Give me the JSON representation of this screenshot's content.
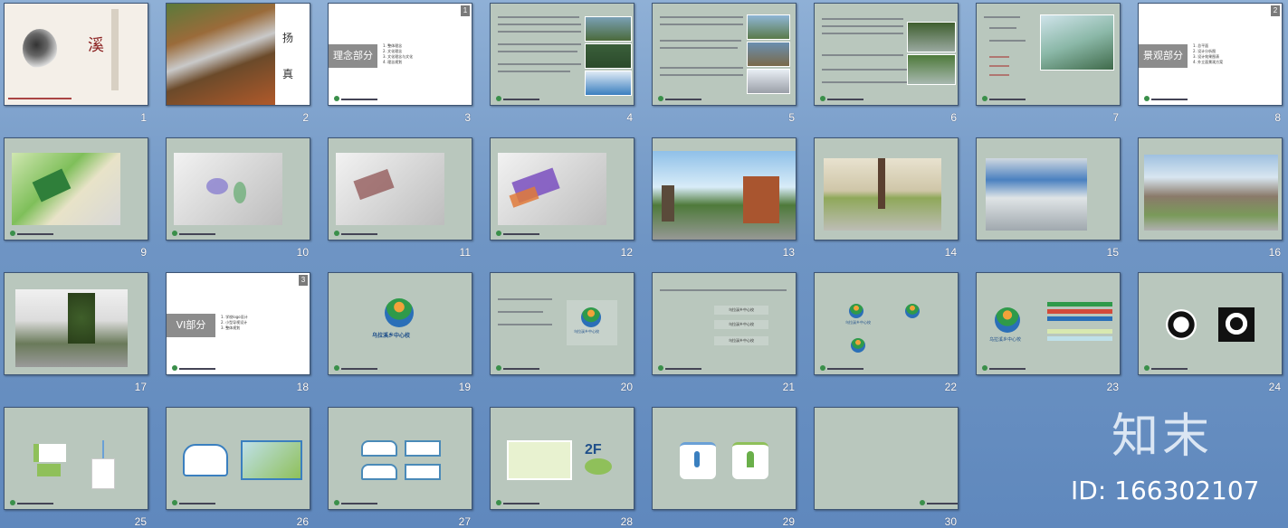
{
  "slides": [
    {
      "num": "1",
      "title": "溪"
    },
    {
      "num": "2",
      "title": "扬 真"
    },
    {
      "num": "3",
      "section": "理念部分",
      "corner": "1",
      "items": [
        "1. 整体理念",
        "2. 文化理念",
        "3. 文化理念与文化",
        "4. 理念规划"
      ]
    },
    {
      "num": "4"
    },
    {
      "num": "5"
    },
    {
      "num": "6"
    },
    {
      "num": "7"
    },
    {
      "num": "8",
      "section": "景观部分",
      "corner": "2",
      "items": [
        "1. 总平面",
        "2. 设计分析图",
        "3. 设计效果图表",
        "4. 外立面景观方案"
      ]
    },
    {
      "num": "9"
    },
    {
      "num": "10"
    },
    {
      "num": "11"
    },
    {
      "num": "12"
    },
    {
      "num": "13"
    },
    {
      "num": "14"
    },
    {
      "num": "15"
    },
    {
      "num": "16"
    },
    {
      "num": "17"
    },
    {
      "num": "18",
      "section": "VI部分",
      "corner": "3",
      "items": [
        "1. 学校logo设计",
        "2. 小型导视设计",
        "3. 整体规划"
      ]
    },
    {
      "num": "19",
      "logo_text": "乌拉溪乡中心校"
    },
    {
      "num": "20",
      "logo_text": "乌拉溪乡中心校"
    },
    {
      "num": "21",
      "rows": [
        "乌拉溪乡中心校",
        "乌拉溪乡中心校",
        "乌拉溪乡中心校"
      ]
    },
    {
      "num": "22",
      "logo_text": "乌拉溪乡中心校"
    },
    {
      "num": "23",
      "logo_text": "乌拉溪乡中心校"
    },
    {
      "num": "24"
    },
    {
      "num": "25"
    },
    {
      "num": "26"
    },
    {
      "num": "27"
    },
    {
      "num": "28",
      "label": "2F"
    },
    {
      "num": "29"
    },
    {
      "num": "30"
    }
  ],
  "watermark": {
    "brand": "知末",
    "id": "ID: 166302107"
  }
}
